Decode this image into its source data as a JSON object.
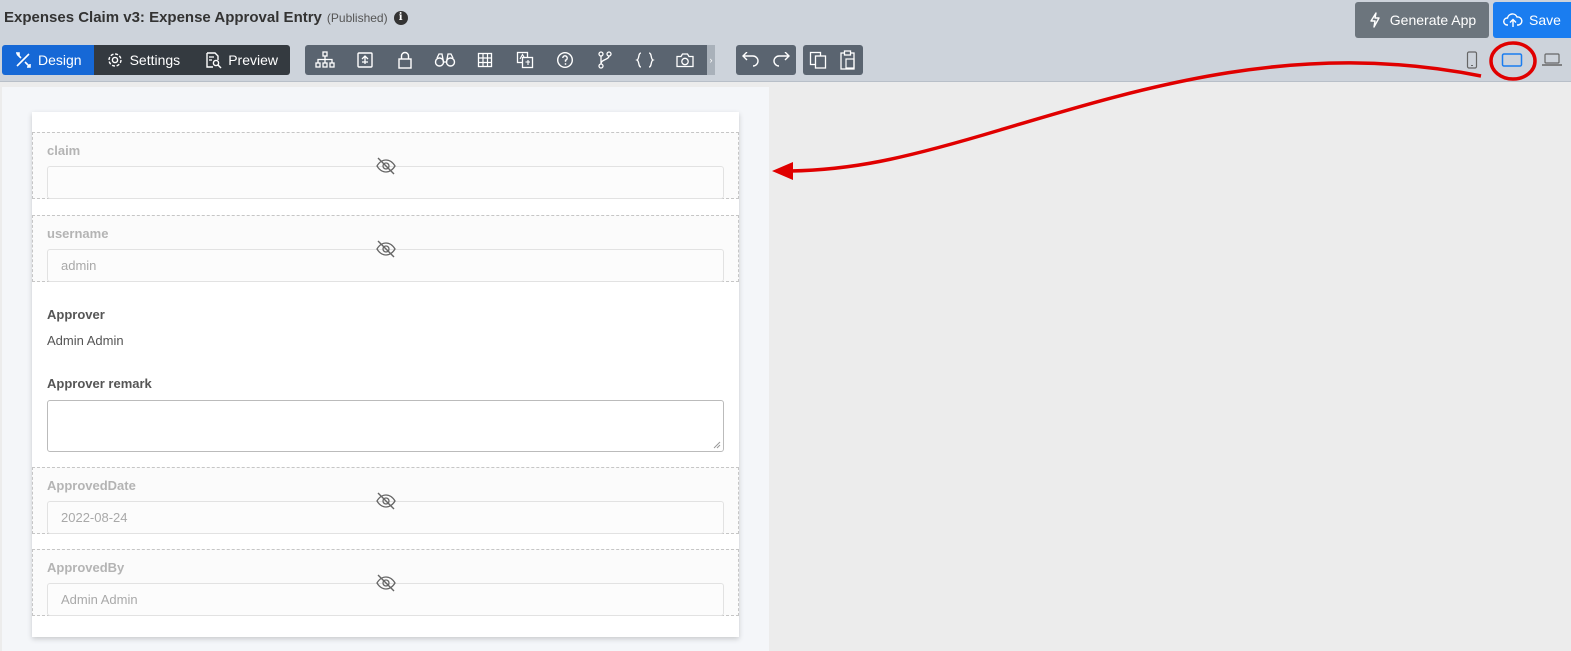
{
  "header": {
    "title": "Expenses Claim v3: Expense Approval Entry",
    "status": "(Published)",
    "info_icon": "i",
    "generate_label": "Generate App",
    "save_label": "Save"
  },
  "modes": [
    {
      "label": "Design",
      "icon": "design-tools-icon",
      "active": true
    },
    {
      "label": "Settings",
      "icon": "gear-icon",
      "active": false
    },
    {
      "label": "Preview",
      "icon": "preview-doc-icon",
      "active": false
    }
  ],
  "toolbar": {
    "tools": [
      "hierarchy-icon",
      "form-upload-icon",
      "lock-icon",
      "binoculars-icon",
      "grid-icon",
      "translate-icon",
      "help-circle-icon",
      "branch-icon",
      "braces-icon",
      "camera-icon"
    ],
    "undo_icons": [
      "undo-icon",
      "redo-icon"
    ],
    "clipboard_icons": [
      "copy-icon",
      "paste-icon"
    ],
    "devices": [
      "phone-icon",
      "tablet-icon",
      "laptop-icon"
    ],
    "selected_device": "tablet-icon"
  },
  "form": {
    "hidden_fields": [
      {
        "label": "claim",
        "value": ""
      },
      {
        "label": "username",
        "value": "admin"
      },
      {
        "label": "ApprovedDate",
        "value": "2022-08-24"
      },
      {
        "label": "ApprovedBy",
        "value": "Admin Admin"
      }
    ],
    "approver_label": "Approver",
    "approver_value": "Admin Admin",
    "remark_label": "Approver remark",
    "remark_value": ""
  },
  "colors": {
    "header_bg": "#cdd3db",
    "primary": "#1a7df0",
    "design_active": "#1668d6",
    "toolbar_bg": "#5a6470",
    "annotation": "#e00000"
  }
}
